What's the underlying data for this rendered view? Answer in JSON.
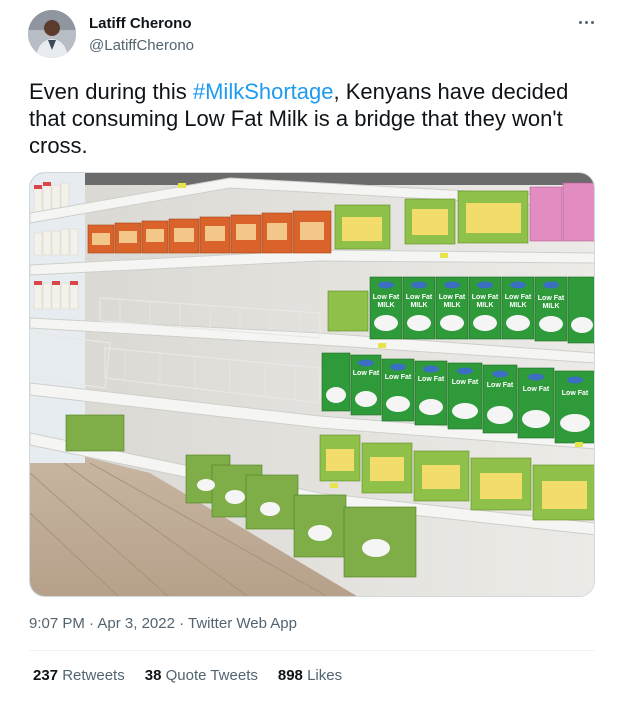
{
  "author": {
    "name": "Latiff Cherono",
    "handle": "@LatiffCherono"
  },
  "tweet": {
    "text_before": "Even during this ",
    "hashtag": "#MilkShortage",
    "text_after": ", Kenyans have decided that consuming Low Fat Milk is a bridge that they won't cross."
  },
  "meta": {
    "time": "9:07 PM",
    "sep1": " · ",
    "date": "Apr 3, 2022",
    "sep2": " · ",
    "source": "Twitter Web App"
  },
  "stats": {
    "retweets_count": "237",
    "retweets_label": " Retweets",
    "quotes_count": "38",
    "quotes_label": " Quote Tweets",
    "likes_count": "898",
    "likes_label": " Likes"
  },
  "photo": {
    "milk_box_text": "Low Fat MILK"
  },
  "colors": {
    "link": "#1d9bf0",
    "secondary_text": "#536471",
    "milk_box_green": "#2f9a3a",
    "juice_box_orange": "#d9632a",
    "value_pack_green": "#8fc04a",
    "pink_box": "#e38cc2"
  }
}
